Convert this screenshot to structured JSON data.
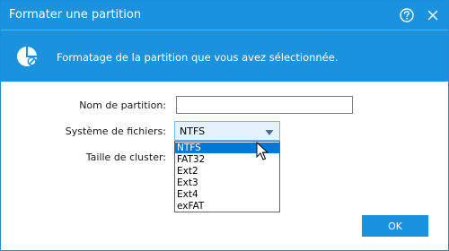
{
  "window": {
    "title": "Formater une partition"
  },
  "banner": {
    "text": "Formatage de la partition que vous avez sélectionnée."
  },
  "form": {
    "partition_name_label": "Nom de partition:",
    "partition_name_value": "",
    "filesystem_label": "Système de fichiers:",
    "filesystem_value": "NTFS",
    "cluster_size_label": "Taille de cluster:"
  },
  "dropdown": {
    "selected_index": 0,
    "options": [
      "NTFS",
      "FAT32",
      "Ext2",
      "Ext3",
      "Ext4",
      "exFAT"
    ]
  },
  "buttons": {
    "ok_label": "OK"
  },
  "colors": {
    "accent": "#1b92dd",
    "selection": "#0078d7"
  },
  "icons": [
    "help-icon",
    "close-icon",
    "partition-format-icon",
    "chevron-down-icon",
    "mouse-cursor-icon"
  ]
}
